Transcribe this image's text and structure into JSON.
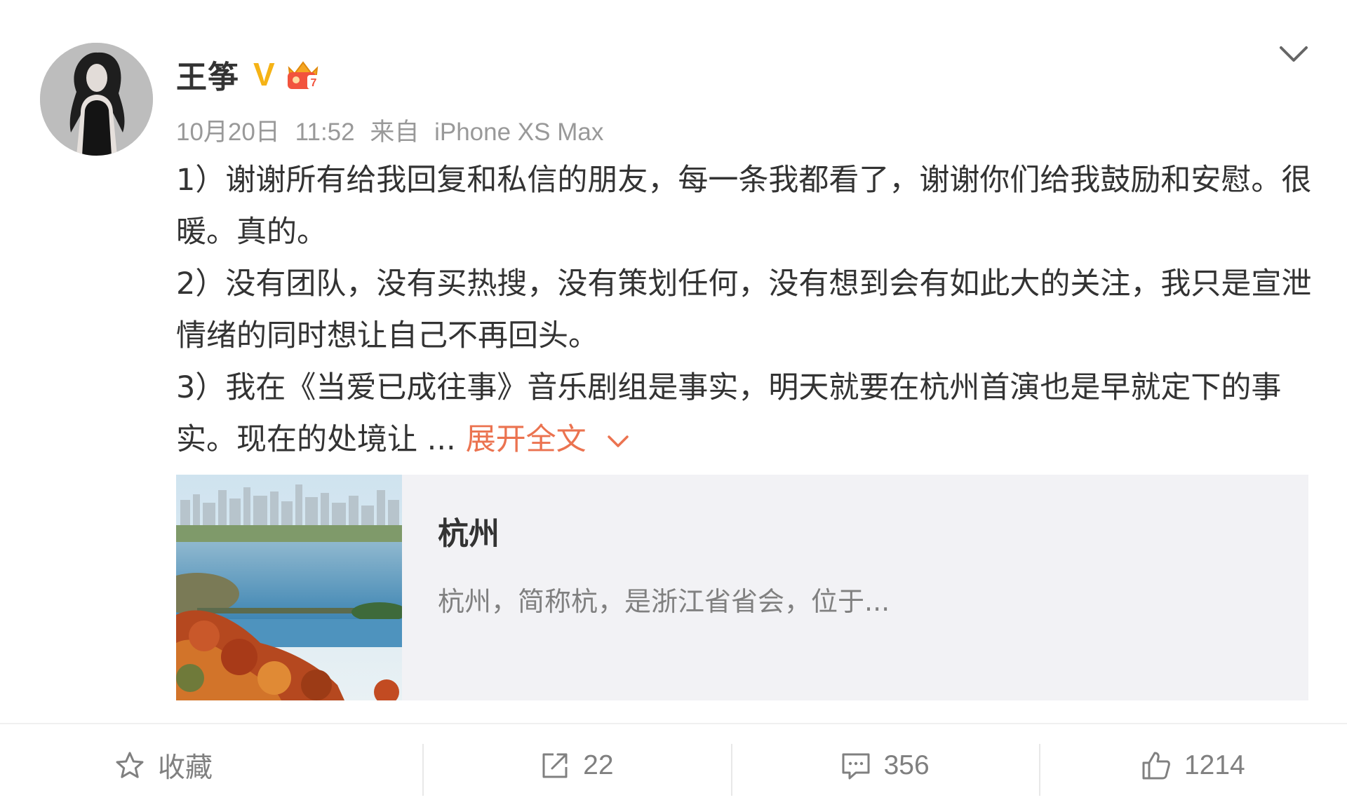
{
  "author": {
    "name": "王筝",
    "verified_badge": "V",
    "verified_color": "#f5b316",
    "vip_badge_icon": "vip-crown-icon",
    "vip_level": "7"
  },
  "meta": {
    "date": "10月20日",
    "time": "11:52",
    "source_prefix": "来自",
    "source_device": "iPhone XS Max"
  },
  "content": {
    "paragraphs": [
      "1）谢谢所有给我回复和私信的朋友，每一条我都看了，谢谢你们给我鼓励和安慰。很暖。真的。",
      "2）没有团队，没有买热搜，没有策划任何，没有想到会有如此大的关注，我只是宣泄情绪的同时想让自己不再回头。",
      "3）我在《当爱已成往事》音乐剧组是事实，明天就要在杭州首演也是早就定下的事实。现在的处境让 ..."
    ],
    "expand_label": "展开全文",
    "link_color": "#eb7350"
  },
  "card": {
    "title": "杭州",
    "description": "杭州，简称杭，是浙江省省会，位于..."
  },
  "actions": {
    "favorite_label": "收藏",
    "repost_count": "22",
    "comment_count": "356",
    "like_count": "1214"
  }
}
